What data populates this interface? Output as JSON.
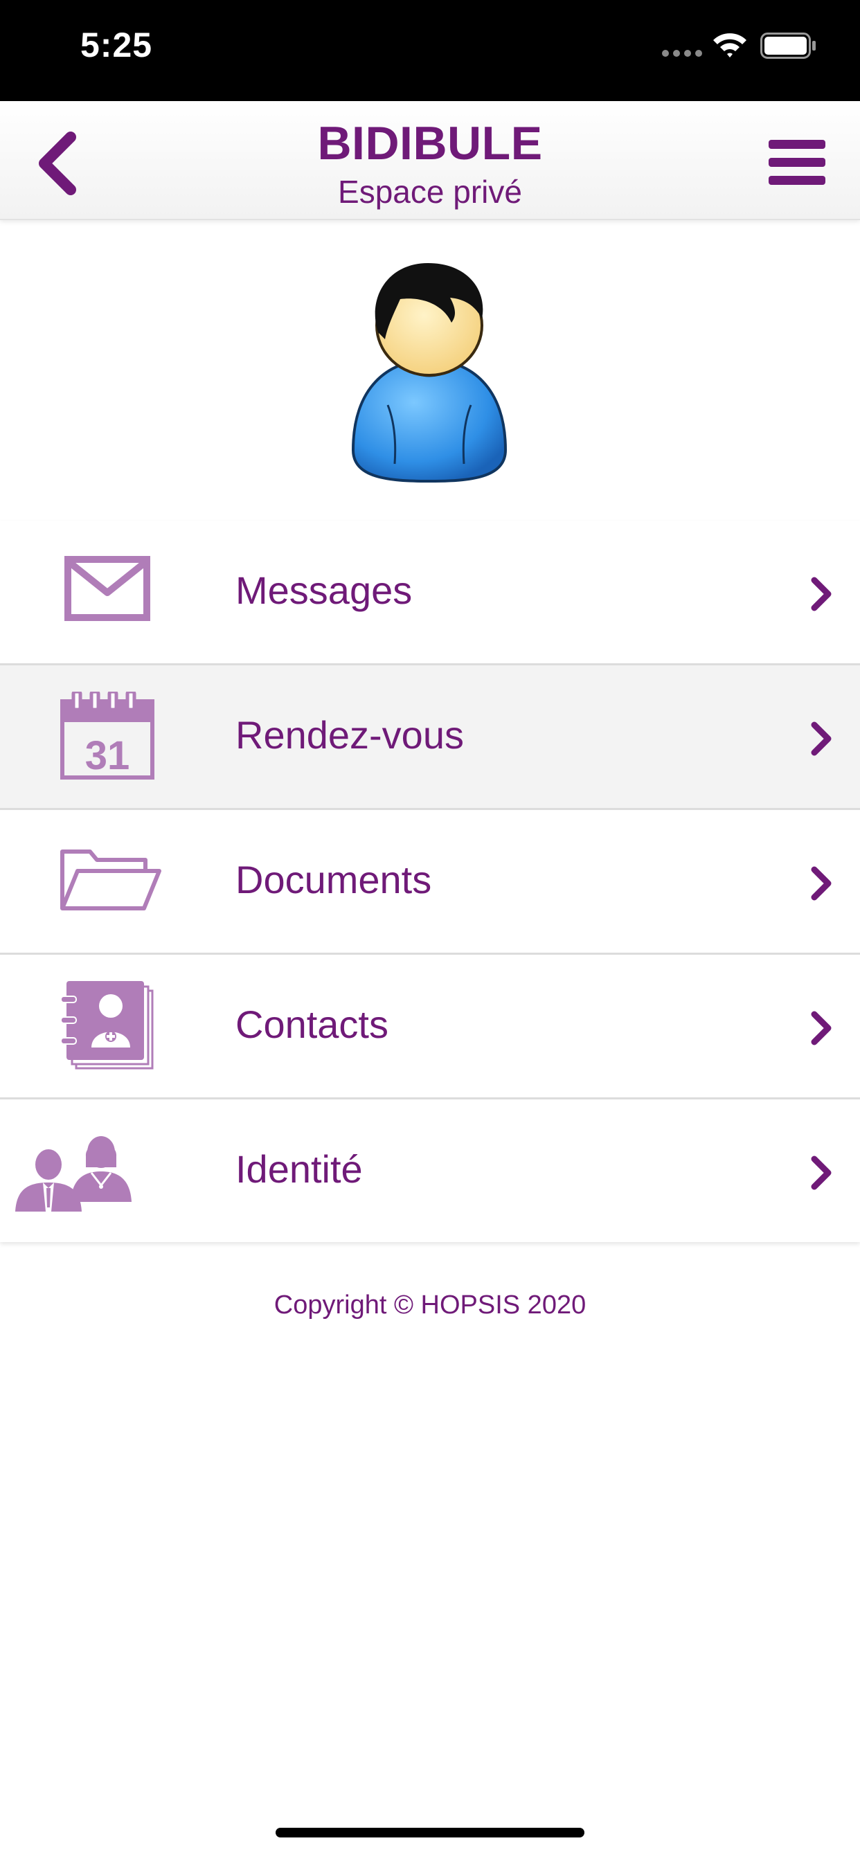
{
  "status_bar": {
    "time": "5:25"
  },
  "header": {
    "title": "BIDIBULE",
    "subtitle": "Espace privé",
    "back_icon": "chevron-left-icon",
    "menu_icon": "hamburger-menu-icon"
  },
  "avatar": {
    "icon": "user-avatar-icon"
  },
  "menu": {
    "items": [
      {
        "label": "Messages",
        "icon": "envelope-icon"
      },
      {
        "label": "Rendez-vous",
        "icon": "calendar-icon",
        "calendar_day": "31"
      },
      {
        "label": "Documents",
        "icon": "folder-icon"
      },
      {
        "label": "Contacts",
        "icon": "address-book-icon"
      },
      {
        "label": "Identité",
        "icon": "people-icon"
      }
    ]
  },
  "footer": {
    "copyright": "Copyright © HOPSIS 2020"
  },
  "colors": {
    "brand": "#6f1a78",
    "icon": "#b07db8",
    "active_row": "#f3f3f3"
  }
}
